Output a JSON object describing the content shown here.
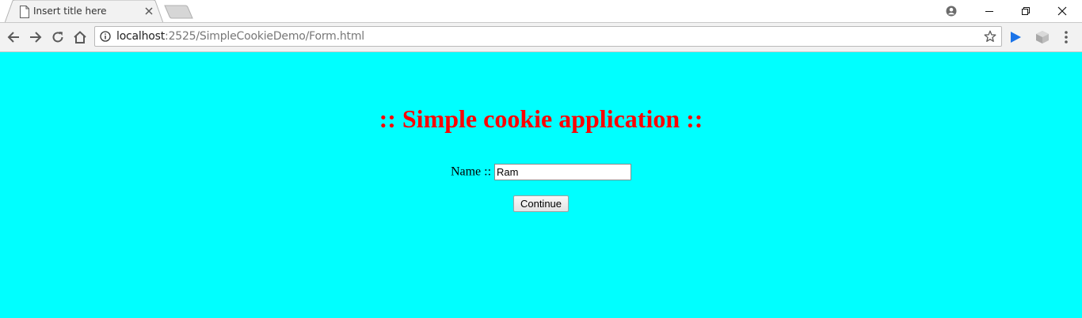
{
  "browser": {
    "tab_title": "Insert title here",
    "url_host": "localhost",
    "url_rest": ":2525/SimpleCookieDemo/Form.html",
    "icons": [
      "file-icon",
      "close-icon",
      "new-tab-icon",
      "profile-icon",
      "minimize-icon",
      "restore-icon",
      "window-close-icon",
      "back-arrow-icon",
      "forward-arrow-icon",
      "reload-icon",
      "home-icon",
      "info-icon",
      "star-icon",
      "play-extension-icon",
      "extension-icon",
      "menu-icon"
    ]
  },
  "page": {
    "background_color": "#00ffff",
    "title": ":: Simple cookie application ::",
    "title_color": "#ff0000",
    "name_label": "Name ::",
    "name_value": "Ram",
    "continue_label": "Continue"
  }
}
